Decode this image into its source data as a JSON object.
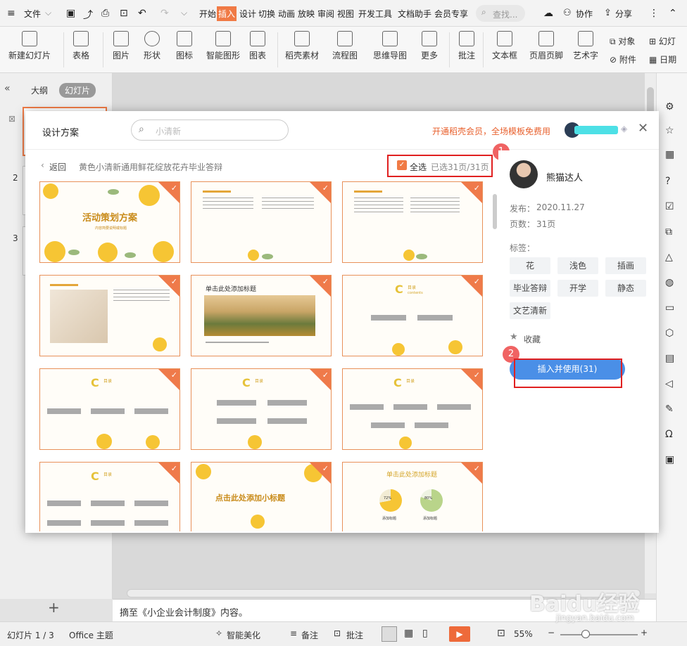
{
  "menu": {
    "file": "文件",
    "tabs": [
      "开始",
      "插入",
      "设计",
      "切换",
      "动画",
      "放映",
      "审阅",
      "视图",
      "开发工具",
      "文档助手",
      "会员专享"
    ],
    "active_tab": "插入",
    "search": "查找...",
    "collab": "协作",
    "share": "分享"
  },
  "ribbon": {
    "new_slide": "新建幻灯片",
    "table": "表格",
    "picture": "图片",
    "shape": "形状",
    "icon": "图标",
    "smartart": "智能图形",
    "chart": "图表",
    "material": "稻壳素材",
    "flowchart": "流程图",
    "mindmap": "思维导图",
    "more": "更多",
    "comment": "批注",
    "textbox": "文本框",
    "header_footer": "页眉页脚",
    "wordart": "艺术字",
    "object": "对象",
    "attachment": "附件",
    "slide_num": "幻灯",
    "date": "日期"
  },
  "leftpane": {
    "outline_tab": "大纲",
    "slides_tab": "幻灯片",
    "slide_numbers": [
      "2",
      "3"
    ]
  },
  "notes": "摘至《小企业会计制度》内容。",
  "status": {
    "slide_info": "幻灯片 1 / 3",
    "theme": "Office 主题",
    "beautify": "智能美化",
    "notes": "备注",
    "comment": "批注",
    "zoom": "55%"
  },
  "dialog": {
    "title": "设计方案",
    "search_placeholder": "小清新",
    "promo": "开通稻壳会员，全场模板免费用",
    "back": "返回",
    "template_name": "黄色小清新通用鲜花绽放花卉毕业答辩",
    "select_all": "全选",
    "selected_info": "已选31页/31页",
    "author": "熊猫达人",
    "publish_label": "发布：",
    "publish_date": "2020.11.27",
    "pages_label": "页数：",
    "pages": "31页",
    "tags_label": "标签：",
    "tags": [
      "花",
      "浅色",
      "插画",
      "毕业答辩",
      "开学",
      "静态",
      "文艺清新"
    ],
    "favorite": "收藏",
    "insert_button": "插入并使用(31)",
    "badge1": "1",
    "badge2": "2",
    "thumbs": {
      "t1_title": "活动策划方案",
      "t1_sub": "内容简要说明或标题",
      "t5_title": "单击此处添加标题",
      "toc_letter": "C",
      "toc_word": "目录",
      "toc_sub": "contents",
      "t11_title": "点击此处添加小标题",
      "t12_title": "单击此处添加标题",
      "pct1": "72%",
      "pct2": "80%",
      "item_label": "添加标题"
    },
    "accent": "#f07a45",
    "button_color": "#4a8fe7"
  },
  "watermark": {
    "brand": "Baidu经验",
    "url": "jingyan.baidu.com"
  }
}
